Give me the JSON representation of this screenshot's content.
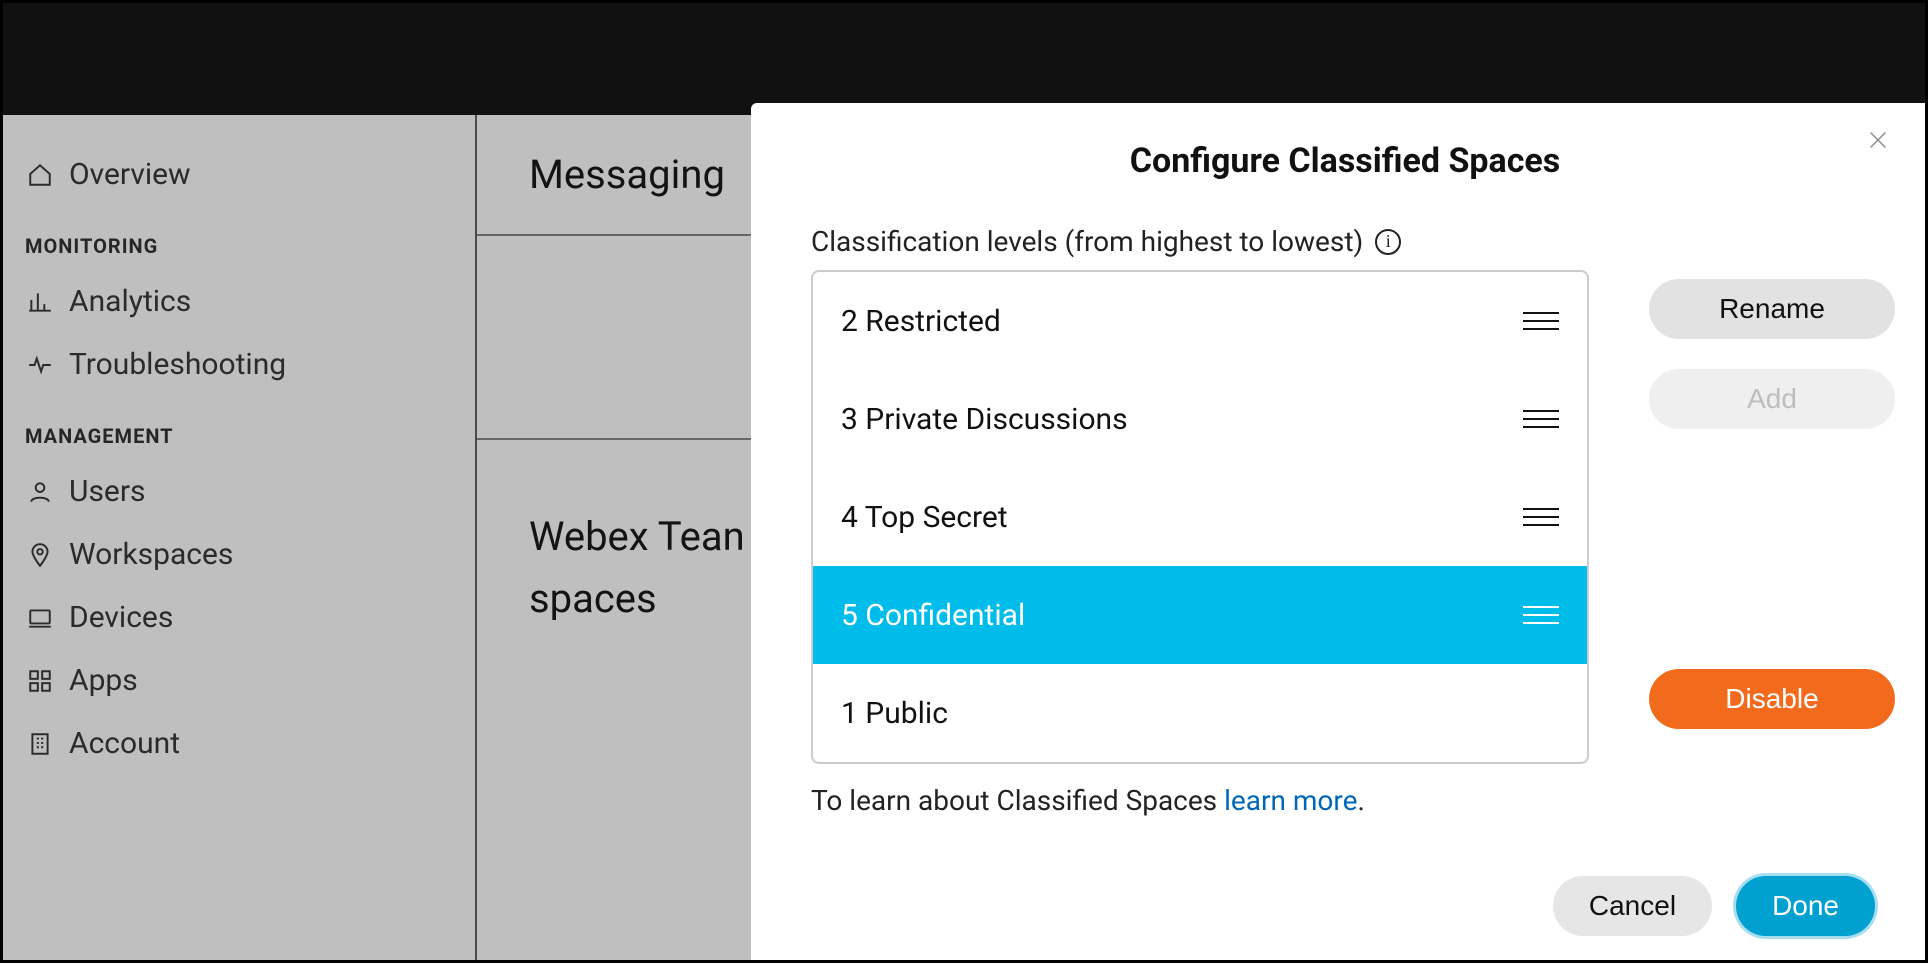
{
  "sidebar": {
    "items": [
      {
        "label": "Overview",
        "icon": "home-icon"
      }
    ],
    "sections": [
      {
        "header": "MONITORING",
        "items": [
          {
            "label": "Analytics",
            "icon": "bar-chart-icon"
          },
          {
            "label": "Troubleshooting",
            "icon": "pulse-icon"
          }
        ]
      },
      {
        "header": "MANAGEMENT",
        "items": [
          {
            "label": "Users",
            "icon": "user-icon"
          },
          {
            "label": "Workspaces",
            "icon": "pin-icon"
          },
          {
            "label": "Devices",
            "icon": "device-icon"
          },
          {
            "label": "Apps",
            "icon": "grid-icon"
          },
          {
            "label": "Account",
            "icon": "building-icon"
          }
        ]
      }
    ]
  },
  "content": {
    "row1": "Messaging",
    "heading_line1": "Webex Tean",
    "heading_line2": "spaces"
  },
  "modal": {
    "title": "Configure Classified Spaces",
    "levels_label": "Classification levels (from highest to lowest)",
    "levels": [
      {
        "label": "2 Restricted",
        "selected": false
      },
      {
        "label": "3 Private Discussions",
        "selected": false
      },
      {
        "label": "4 Top Secret",
        "selected": false
      },
      {
        "label": "5 Confidential",
        "selected": true
      },
      {
        "label": "1 Public",
        "selected": false
      }
    ],
    "help_prefix": "To learn about Classified Spaces ",
    "help_link": "learn more",
    "help_suffix": ".",
    "buttons": {
      "rename": "Rename",
      "add": "Add",
      "disable": "Disable",
      "cancel": "Cancel",
      "done": "Done"
    }
  }
}
